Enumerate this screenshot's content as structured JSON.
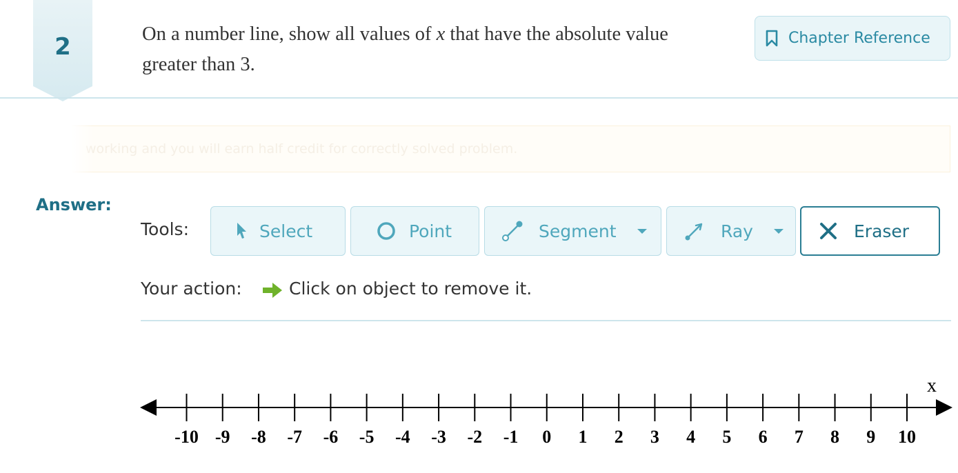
{
  "question": {
    "number": "2",
    "text_before": "On a number line, show all values of ",
    "variable": "x",
    "text_after": " that have the absolute value greater than 3."
  },
  "chapter_reference": {
    "label": "Chapter Reference",
    "icon": "bookmark-icon"
  },
  "notice": {
    "text": "working and you will earn half credit for correctly solved problem."
  },
  "answer": {
    "label": "Answer:"
  },
  "tools": {
    "label": "Tools:",
    "items": [
      {
        "label": "Select",
        "icon": "cursor-icon",
        "dropdown": false,
        "active": false
      },
      {
        "label": "Point",
        "icon": "point-icon",
        "dropdown": false,
        "active": false
      },
      {
        "label": "Segment",
        "icon": "segment-icon",
        "dropdown": true,
        "active": false
      },
      {
        "label": "Ray",
        "icon": "ray-icon",
        "dropdown": true,
        "active": false
      },
      {
        "label": "Eraser",
        "icon": "close-icon",
        "dropdown": false,
        "active": true
      }
    ]
  },
  "action": {
    "label": "Your action:",
    "icon": "arrow-right-icon",
    "text": "Click on object to remove it."
  },
  "number_line": {
    "axis_label": "x",
    "min": -10,
    "max": 10,
    "ticks": [
      "-10",
      "-9",
      "-8",
      "-7",
      "-6",
      "-5",
      "-4",
      "-3",
      "-2",
      "-1",
      "0",
      "1",
      "2",
      "3",
      "4",
      "5",
      "6",
      "7",
      "8",
      "9",
      "10"
    ]
  },
  "colors": {
    "accent": "#1f6f86",
    "tool_text": "#4fa7bc",
    "tool_bg": "#eaf6f9",
    "action_arrow": "#6fb22b"
  }
}
